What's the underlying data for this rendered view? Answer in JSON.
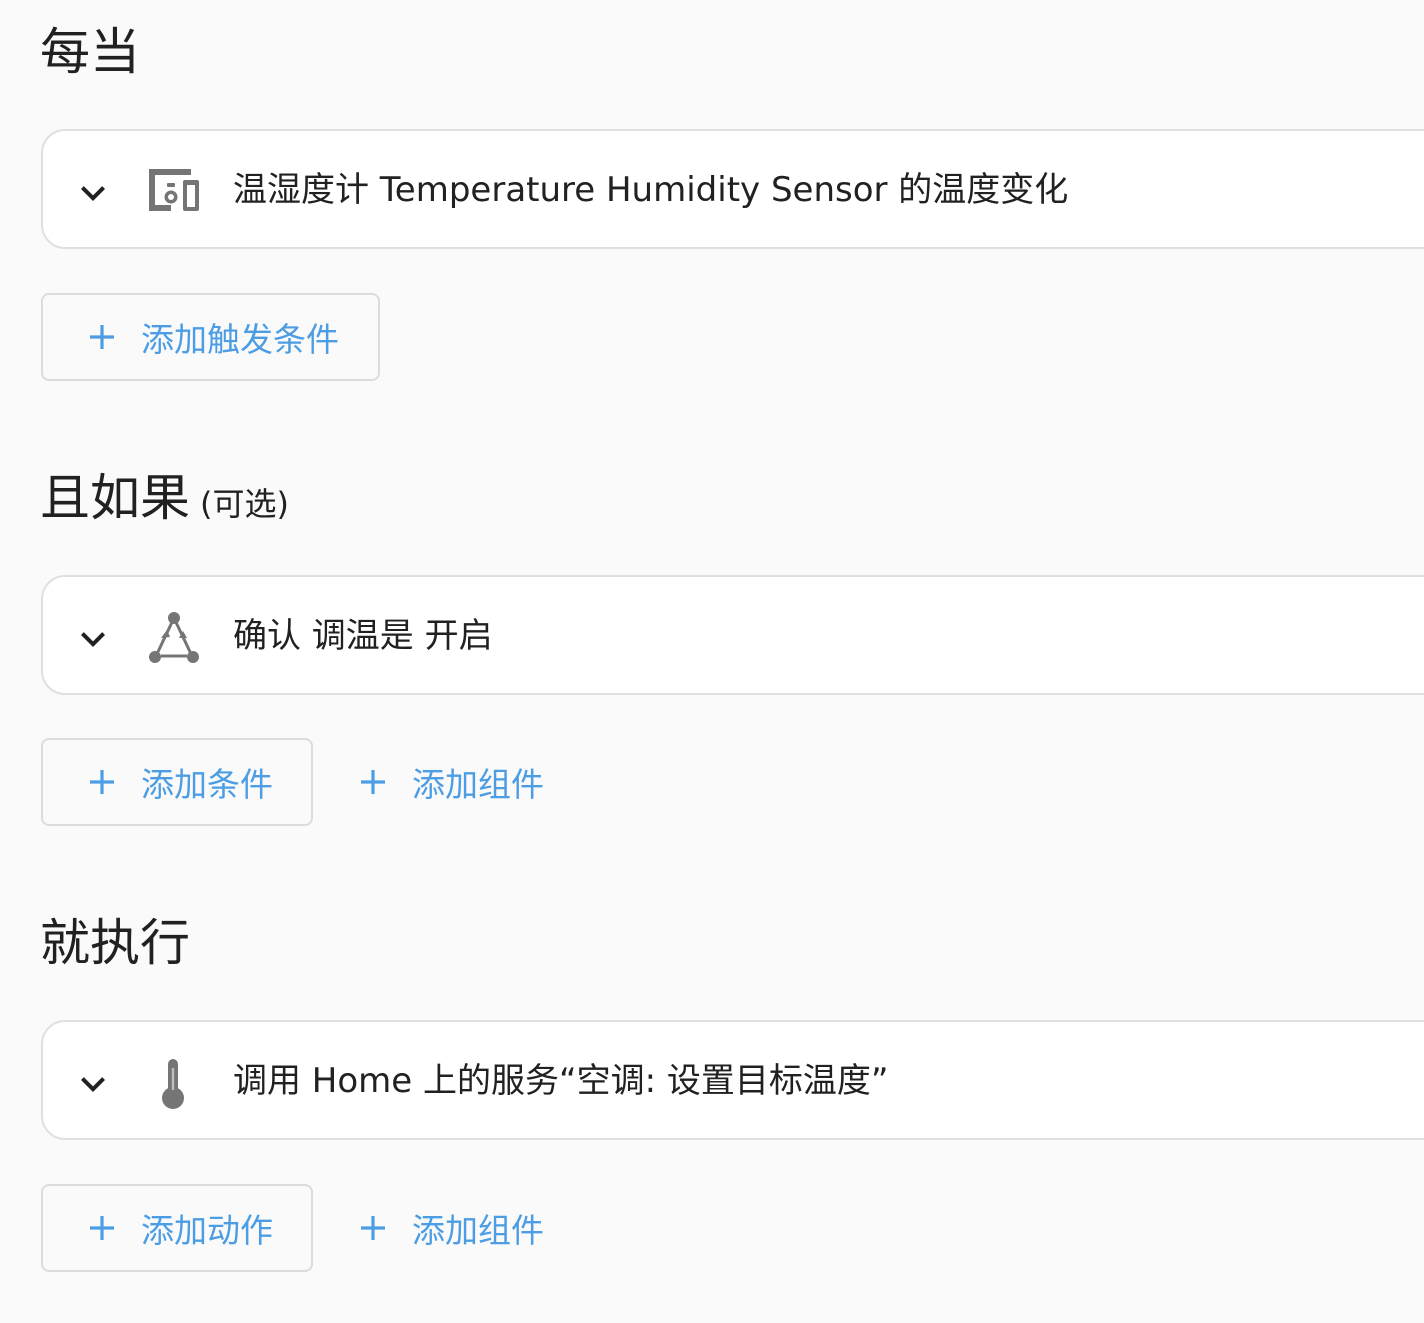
{
  "sections": {
    "trigger": {
      "title": "每当",
      "card_text": "温湿度计 Temperature Humidity Sensor 的温度变化",
      "add_button": "添加触发条件"
    },
    "condition": {
      "title": "且如果",
      "optional": "(可选)",
      "card_text": "确认 调温是 开启",
      "add_button": "添加条件",
      "add_building_block": "添加组件"
    },
    "action": {
      "title": "就执行",
      "card_text": "调用 Home 上的服务“空调: 设置目标温度”",
      "add_button": "添加动作",
      "add_building_block": "添加组件"
    }
  },
  "icons": {
    "expand": "chevron-down-icon",
    "trigger": "devices-icon",
    "condition": "state-triangle-icon",
    "action": "thermometer-icon",
    "add": "plus-icon"
  },
  "colors": {
    "accent": "#4c9de3",
    "icon": "#757575",
    "text": "#212121",
    "background": "#fafafa",
    "card": "#ffffff",
    "border": "#e0e0e0"
  }
}
